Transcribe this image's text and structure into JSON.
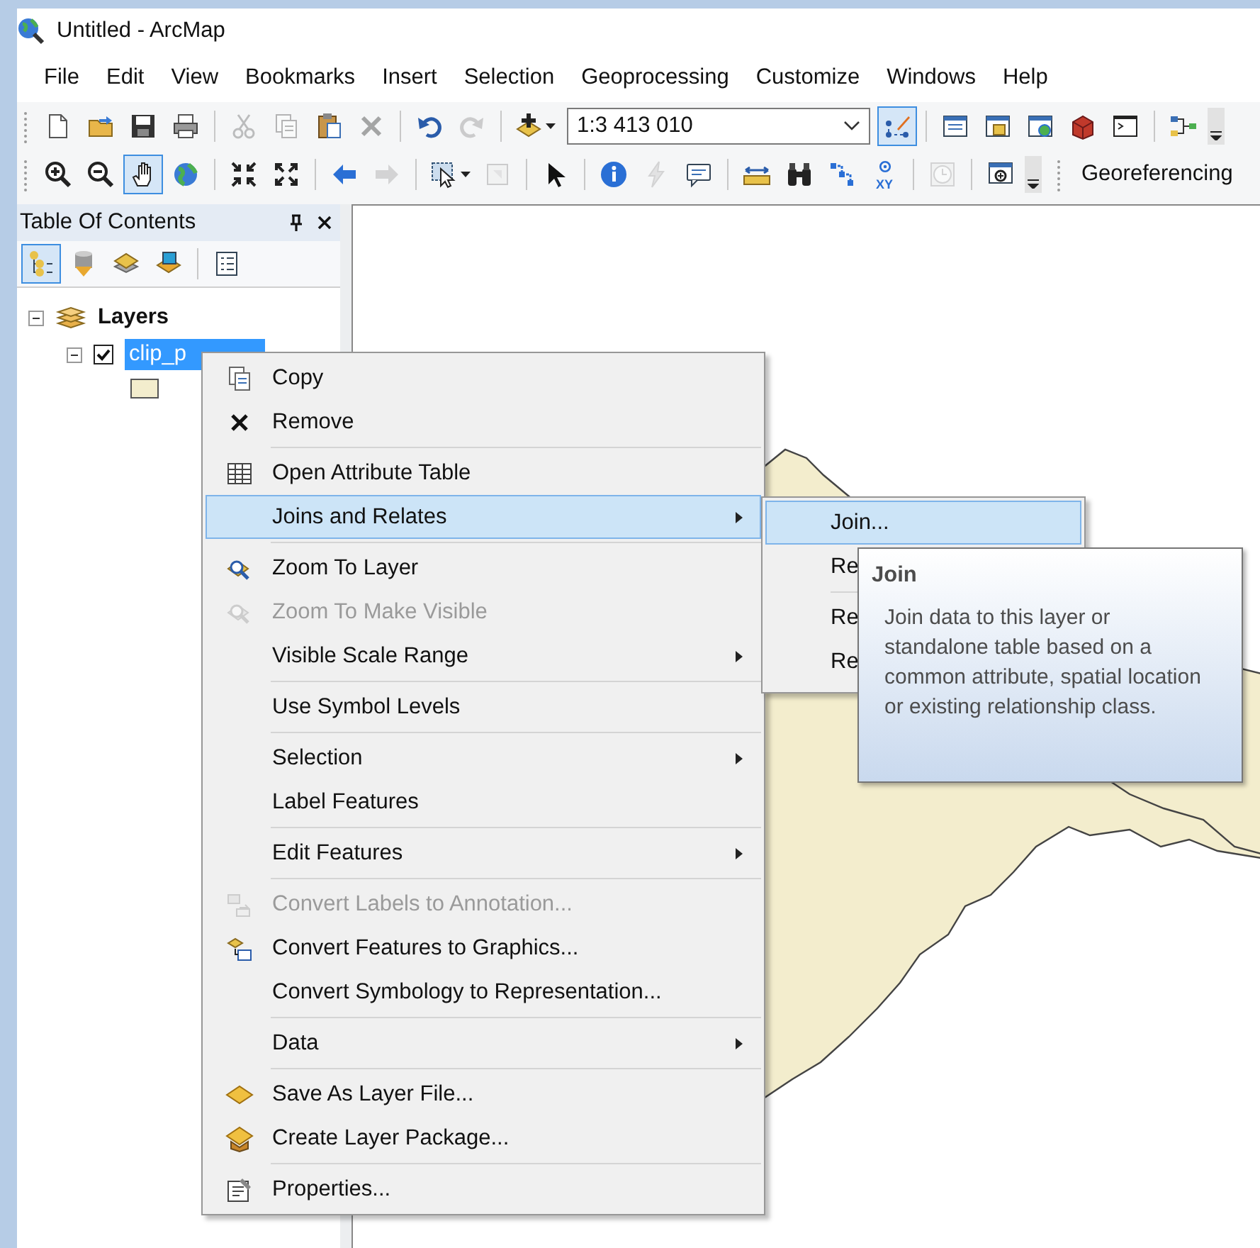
{
  "window": {
    "title": "Untitled - ArcMap"
  },
  "menu_bar": [
    "File",
    "Edit",
    "View",
    "Bookmarks",
    "Insert",
    "Selection",
    "Geoprocessing",
    "Customize",
    "Windows",
    "Help"
  ],
  "toolbars": [
    {
      "buttons": [
        {
          "disabled": false,
          "pressed": false
        },
        {
          "disabled": false,
          "pressed": false
        },
        {
          "disabled": false,
          "pressed": false
        },
        {
          "disabled": false,
          "pressed": false
        },
        {
          "disabled": true,
          "pressed": false
        },
        {
          "disabled": true,
          "pressed": false
        },
        {
          "disabled": false,
          "pressed": false
        },
        {
          "disabled": true,
          "pressed": false
        },
        {
          "disabled": false,
          "pressed": false
        },
        {
          "disabled": true,
          "pressed": false
        },
        {
          "disabled": false,
          "pressed": false
        },
        {
          "disabled": false,
          "pressed": true
        },
        {
          "disabled": false,
          "pressed": false
        },
        {
          "disabled": false,
          "pressed": false
        },
        {
          "disabled": false,
          "pressed": false
        },
        {
          "disabled": false,
          "pressed": false
        },
        {
          "disabled": false,
          "pressed": false
        },
        {
          "disabled": false,
          "pressed": false
        }
      ]
    },
    {
      "buttons": [
        {
          "disabled": false,
          "pressed": false
        },
        {
          "disabled": false,
          "pressed": false
        },
        {
          "disabled": false,
          "pressed": true
        },
        {
          "disabled": false,
          "pressed": false
        },
        {
          "disabled": false,
          "pressed": false
        },
        {
          "disabled": false,
          "pressed": false
        },
        {
          "disabled": false,
          "pressed": false
        },
        {
          "disabled": true,
          "pressed": false
        },
        {
          "disabled": false,
          "pressed": false
        },
        {
          "disabled": true,
          "pressed": false
        },
        {
          "disabled": false,
          "pressed": false
        },
        {
          "disabled": false,
          "pressed": false
        },
        {
          "disabled": true,
          "pressed": false
        },
        {
          "disabled": false,
          "pressed": false
        },
        {
          "disabled": false,
          "pressed": false
        },
        {
          "disabled": false,
          "pressed": false
        },
        {
          "disabled": false,
          "pressed": false
        },
        {
          "disabled": false,
          "pressed": false,
          "label": "XY"
        },
        {
          "disabled": true,
          "pressed": false
        },
        {
          "disabled": false,
          "pressed": false
        }
      ]
    }
  ],
  "scale_field": {
    "value": "1:3 413 010"
  },
  "georeferencing": "Georeferencing",
  "toc": {
    "title": "Table Of Contents",
    "buttons": [
      {
        "selected": true
      },
      {
        "selected": false
      },
      {
        "selected": false
      },
      {
        "selected": false
      },
      {
        "selected": false
      }
    ],
    "layers": [
      {
        "label": "Layers",
        "expanded": true,
        "children": [
          {
            "label": "clip_p",
            "checked": true,
            "selected": true,
            "expanded": true
          }
        ]
      }
    ]
  },
  "context_menu": {
    "groups": [
      {
        "items": [
          {
            "label": "Copy",
            "disabled": false,
            "selected": false,
            "submenu": false
          },
          {
            "label": "Remove",
            "disabled": false,
            "selected": false,
            "submenu": false
          }
        ]
      },
      {
        "items": [
          {
            "label": "Open Attribute Table",
            "disabled": false,
            "selected": false,
            "submenu": false
          },
          {
            "label": "Joins and Relates",
            "disabled": false,
            "selected": true,
            "submenu": true
          }
        ]
      },
      {
        "items": [
          {
            "label": "Zoom To Layer",
            "disabled": false,
            "selected": false,
            "submenu": false
          },
          {
            "label": "Zoom To Make Visible",
            "disabled": true,
            "selected": false,
            "submenu": false
          },
          {
            "label": "Visible Scale Range",
            "disabled": false,
            "selected": false,
            "submenu": true
          }
        ]
      },
      {
        "items": [
          {
            "label": "Use Symbol Levels",
            "disabled": false,
            "selected": false,
            "submenu": false
          }
        ]
      },
      {
        "items": [
          {
            "label": "Selection",
            "disabled": false,
            "selected": false,
            "submenu": true
          },
          {
            "label": "Label Features",
            "disabled": false,
            "selected": false,
            "submenu": false
          }
        ]
      },
      {
        "items": [
          {
            "label": "Edit Features",
            "disabled": false,
            "selected": false,
            "submenu": true
          }
        ]
      },
      {
        "items": [
          {
            "label": "Convert Labels to Annotation...",
            "disabled": true,
            "selected": false,
            "submenu": false
          },
          {
            "label": "Convert Features to Graphics...",
            "disabled": false,
            "selected": false,
            "submenu": false
          },
          {
            "label": "Convert Symbology to Representation...",
            "disabled": false,
            "selected": false,
            "submenu": false
          }
        ]
      },
      {
        "items": [
          {
            "label": "Data",
            "disabled": false,
            "selected": false,
            "submenu": true
          }
        ]
      },
      {
        "items": [
          {
            "label": "Save As Layer File...",
            "disabled": false,
            "selected": false,
            "submenu": false
          },
          {
            "label": "Create Layer Package...",
            "disabled": false,
            "selected": false,
            "submenu": false
          }
        ]
      },
      {
        "items": [
          {
            "label": "Properties...",
            "disabled": false,
            "selected": false,
            "submenu": false
          }
        ]
      }
    ]
  },
  "submenu": {
    "groups": [
      {
        "items": [
          {
            "label": "Join...",
            "selected": true
          },
          {
            "label": "Re",
            "selected": false
          }
        ]
      },
      {
        "items": [
          {
            "label": "Re",
            "selected": false
          },
          {
            "label": "Re",
            "selected": false
          }
        ]
      }
    ]
  },
  "tooltip": {
    "title": "Join",
    "text": "Join data to this layer or standalone table based on a common attribute, spatial location or existing relationship class."
  }
}
